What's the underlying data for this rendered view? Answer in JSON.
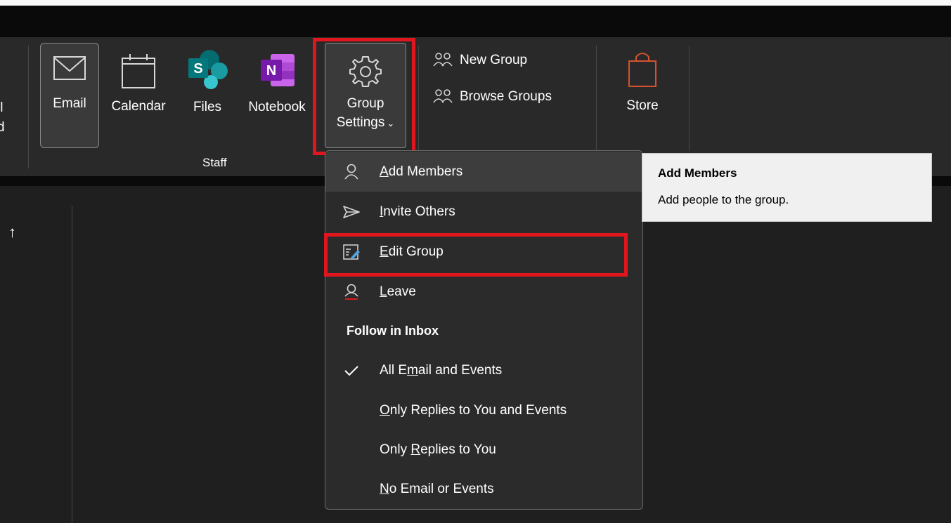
{
  "ribbon": {
    "cut_label_line1": "ll",
    "cut_label_line2": "d",
    "email_label": "Email",
    "calendar_label": "Calendar",
    "files_label": "Files",
    "notebook_label": "Notebook",
    "settings_label_line1": "Group",
    "settings_label_line2": "Settings",
    "new_group_label": "New Group",
    "browse_groups_label": "Browse Groups",
    "store_label": "Store",
    "group_name": "Staff"
  },
  "icons": {
    "email": "mail-icon",
    "calendar": "calendar-icon",
    "files": "sharepoint-icon",
    "notebook": "onenote-icon",
    "settings": "gear-icon",
    "new_group": "people-icon",
    "store": "store-bag-icon"
  },
  "menu": {
    "items": [
      {
        "pre": "",
        "u": "A",
        "post": "dd Members",
        "icon": "person-icon"
      },
      {
        "pre": "",
        "u": "I",
        "post": "nvite Others",
        "icon": "send-icon"
      },
      {
        "pre": "",
        "u": "E",
        "post": "dit Group",
        "icon": "edit-icon"
      },
      {
        "pre": "",
        "u": "L",
        "post": "eave",
        "icon": "leave-person-icon"
      }
    ],
    "section_header": "Follow in Inbox",
    "follow_options": [
      {
        "pre": "All E",
        "u": "m",
        "post": "ail and Events",
        "checked": true
      },
      {
        "pre": "",
        "u": "O",
        "post": "nly Replies to You and Events",
        "checked": false
      },
      {
        "pre": "Only ",
        "u": "R",
        "post": "eplies to You",
        "checked": false
      },
      {
        "pre": "",
        "u": "N",
        "post": "o Email or Events",
        "checked": false
      }
    ]
  },
  "tooltip": {
    "title": "Add Members",
    "description": "Add people to the group."
  },
  "content": {
    "sort_arrow": "↑"
  },
  "colors": {
    "highlight_red": "#e0161e",
    "sharepoint_teal": "#03787c",
    "onenote_purple": "#7719aa",
    "store_orange": "#d35230"
  }
}
